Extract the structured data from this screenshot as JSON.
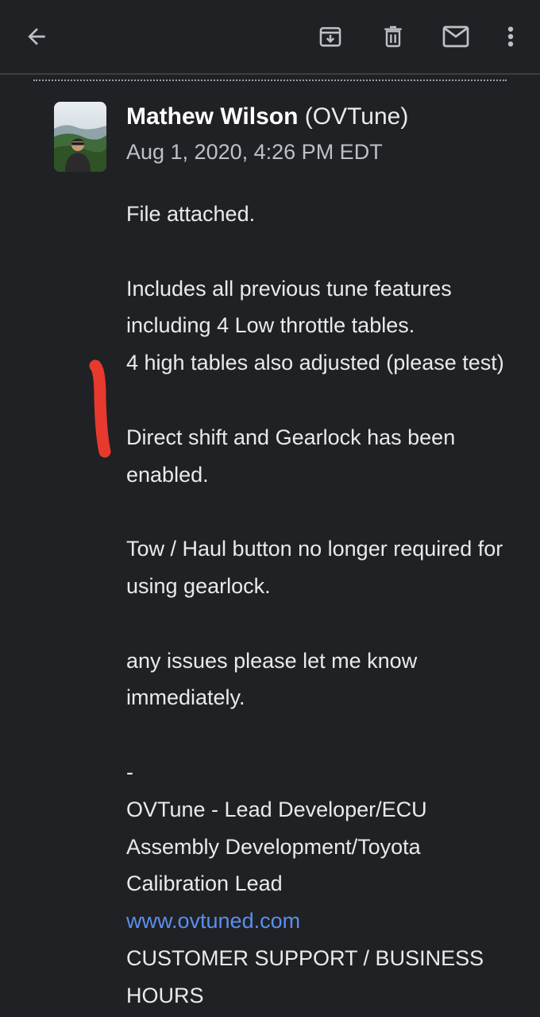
{
  "toolbar": {
    "back_icon": "arrow-back-icon",
    "archive_icon": "archive-icon",
    "delete_icon": "trash-icon",
    "mark_unread_icon": "mail-icon",
    "more_icon": "more-vert-icon"
  },
  "message": {
    "sender_name": "Mathew Wilson",
    "sender_org": "(OVTune)",
    "date": "Aug 1, 2020, 4:26 PM EDT",
    "paragraphs": [
      "File attached.",
      "Includes all previous tune features including 4 Low throttle tables.\n4 high tables also adjusted (please test)",
      "Direct shift and Gearlock has been enabled.",
      "Tow / Haul button no longer required for using gearlock.",
      "any issues please let me know immediately."
    ],
    "signature": {
      "dash": "-",
      "title": "OVTune - Lead Developer/ECU Assembly Development/Toyota Calibration Lead",
      "website": "www.ovtuned.com",
      "support": "CUSTOMER SUPPORT / BUSINESS HOURS"
    }
  },
  "colors": {
    "background": "#202124",
    "text": "#e8eaed",
    "link": "#5a8ff0",
    "annotation": "#e8392f"
  }
}
